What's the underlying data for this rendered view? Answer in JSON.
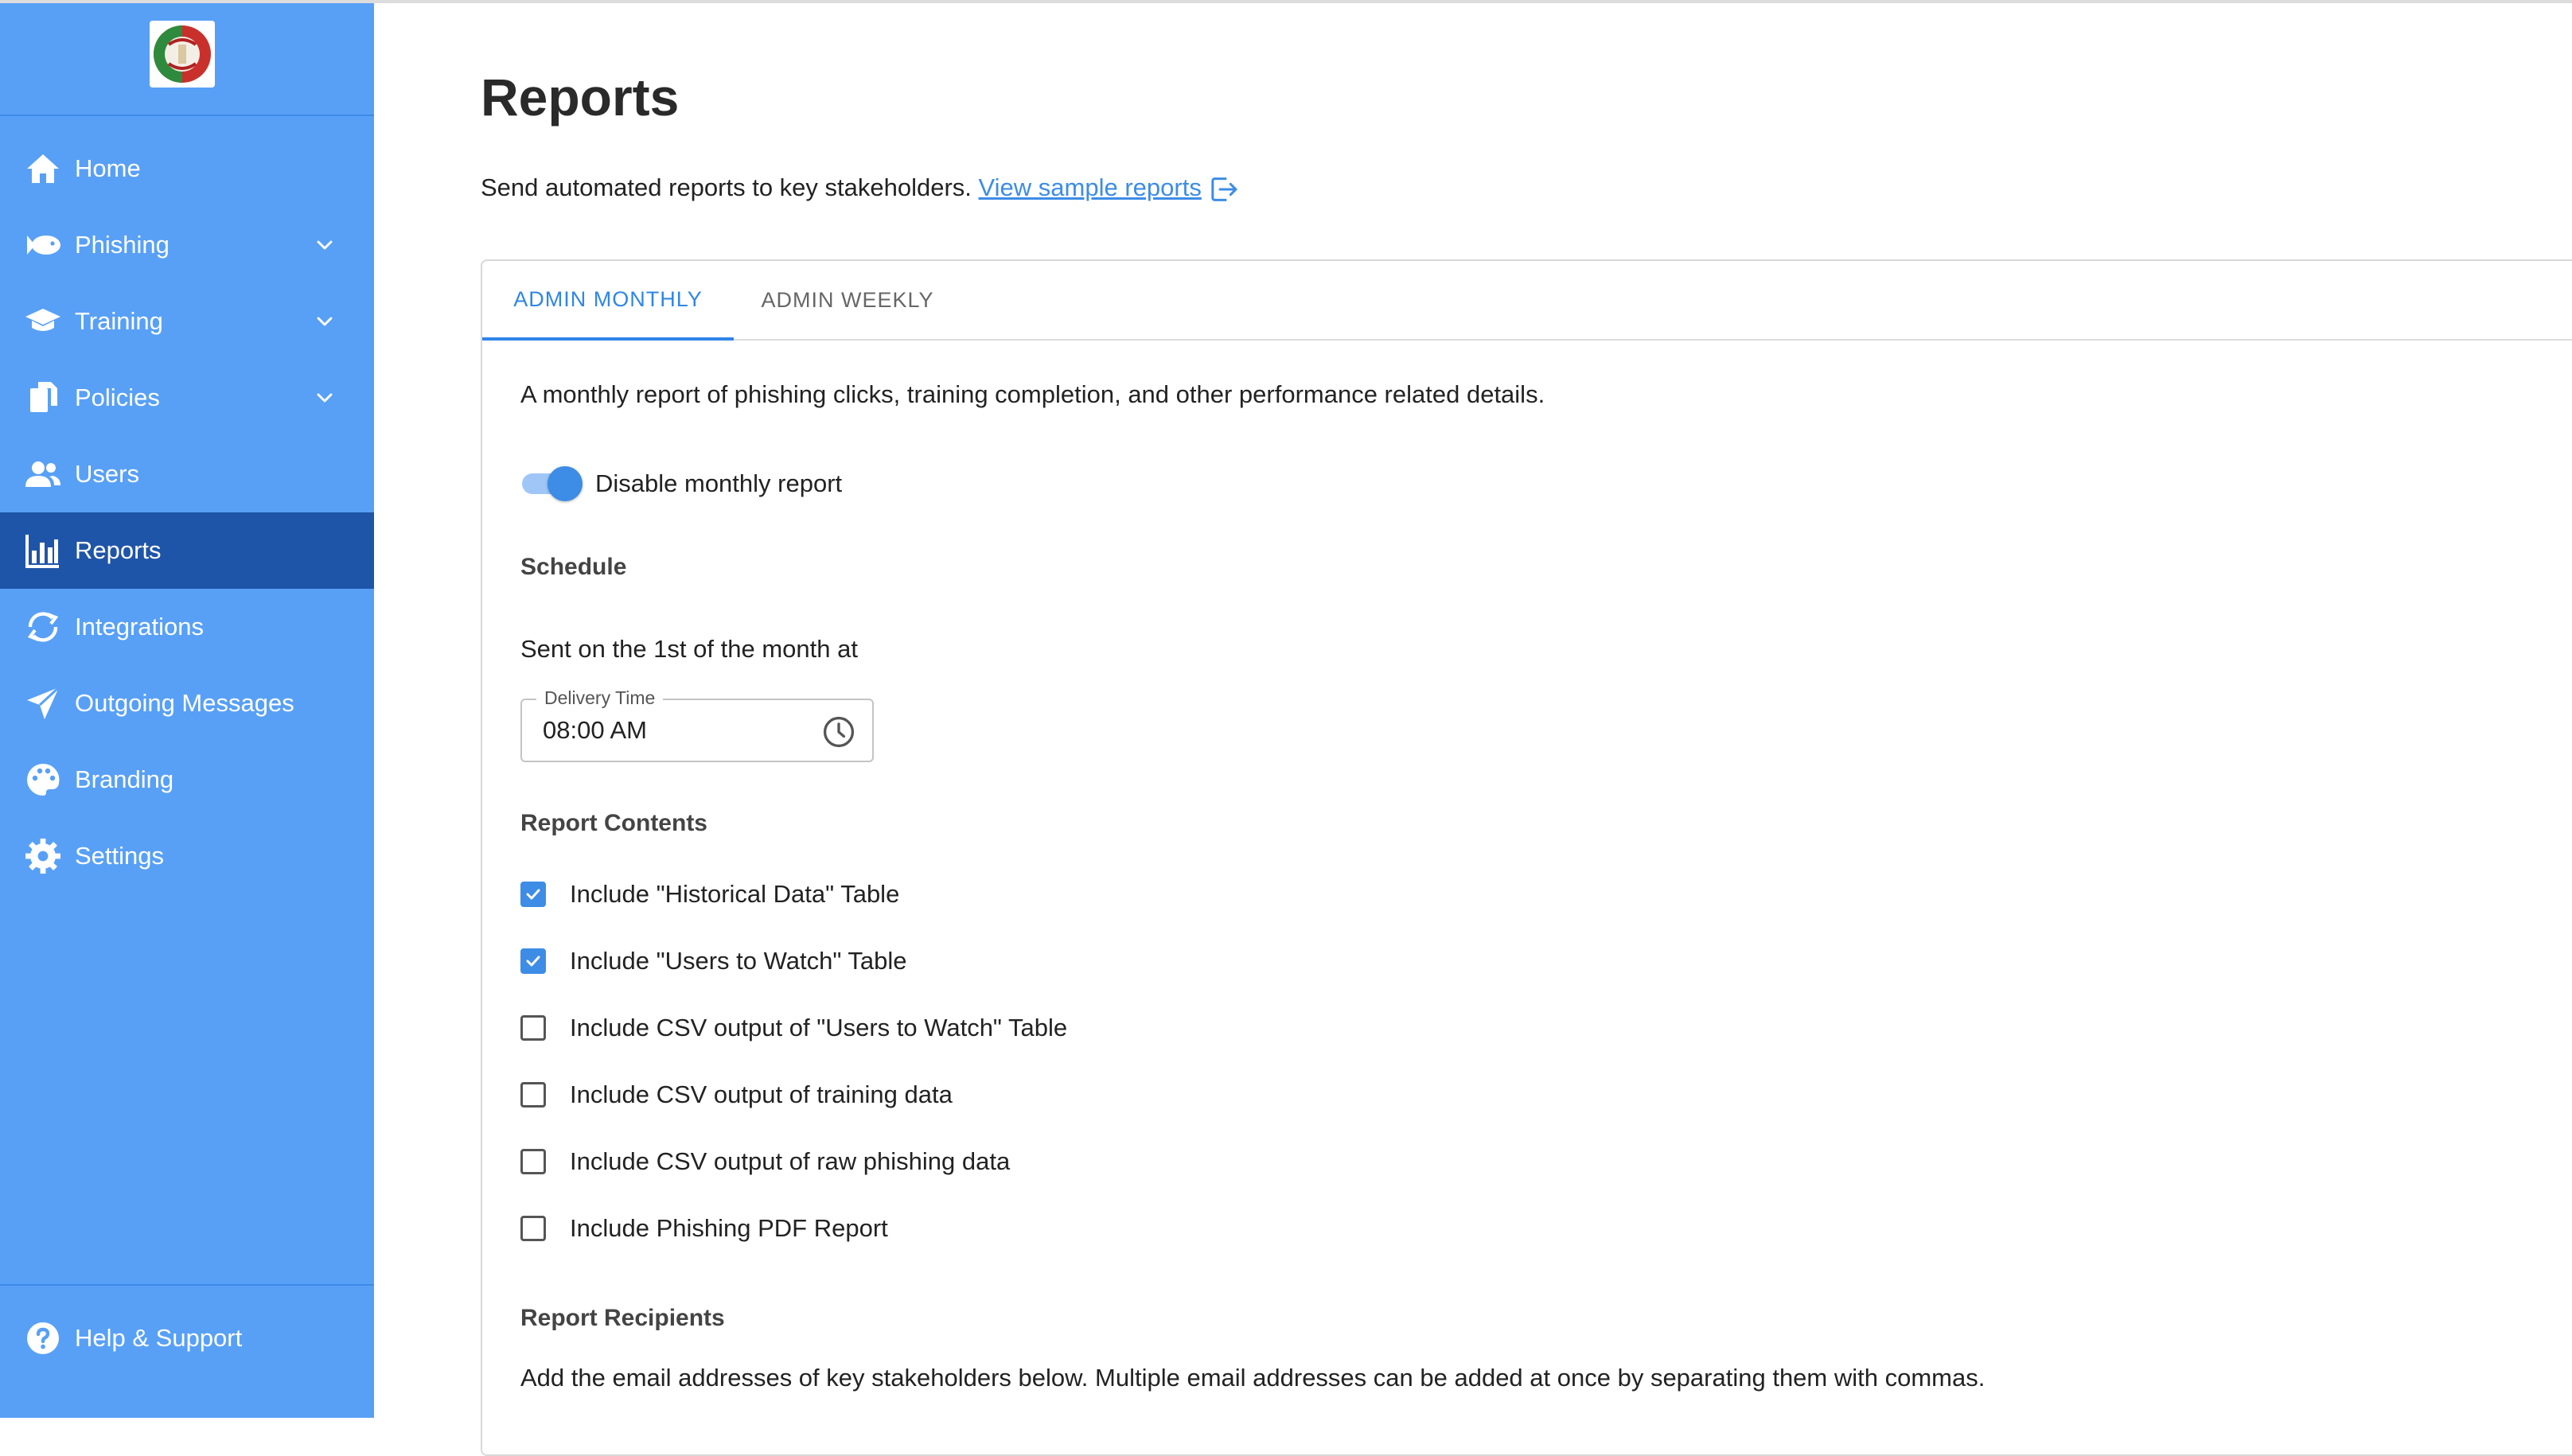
{
  "sidebar": {
    "items": [
      {
        "label": "Home",
        "icon": "home-icon"
      },
      {
        "label": "Phishing",
        "icon": "fish-icon"
      },
      {
        "label": "Training",
        "icon": "graduation-cap-icon"
      },
      {
        "label": "Policies",
        "icon": "documents-icon"
      },
      {
        "label": "Users",
        "icon": "users-icon"
      },
      {
        "label": "Reports",
        "icon": "bar-chart-icon"
      },
      {
        "label": "Integrations",
        "icon": "sync-icon"
      },
      {
        "label": "Outgoing Messages",
        "icon": "paper-plane-icon"
      },
      {
        "label": "Branding",
        "icon": "palette-icon"
      },
      {
        "label": "Settings",
        "icon": "gear-icon"
      }
    ],
    "active": "Reports",
    "help_label": "Help & Support"
  },
  "page": {
    "title": "Reports",
    "subtitle": "Send automated reports to key stakeholders.",
    "sample_link": "View sample reports"
  },
  "tabs": [
    {
      "label": "ADMIN MONTHLY",
      "active": true
    },
    {
      "label": "ADMIN WEEKLY",
      "active": false
    }
  ],
  "monthly": {
    "description": "A monthly report of phishing clicks, training completion, and other performance related details.",
    "toggle_label": "Disable monthly report",
    "toggle_on": true,
    "schedule_heading": "Schedule",
    "sent_text": "Sent on the 1st of the month at",
    "delivery_label": "Delivery Time",
    "delivery_value": "08:00 AM",
    "contents_heading": "Report Contents",
    "options": [
      {
        "label": "Include \"Historical Data\" Table",
        "checked": true
      },
      {
        "label": "Include \"Users to Watch\" Table",
        "checked": true
      },
      {
        "label": "Include CSV output of \"Users to Watch\" Table",
        "checked": false
      },
      {
        "label": "Include CSV output of training data",
        "checked": false
      },
      {
        "label": "Include CSV output of raw phishing data",
        "checked": false
      },
      {
        "label": "Include Phishing PDF Report",
        "checked": false
      }
    ],
    "recipients_heading": "Report Recipients",
    "recipients_desc": "Add the email addresses of key stakeholders below. Multiple email addresses can be added at once by separating them with commas."
  },
  "colors": {
    "sidebar": "#58a0f6",
    "sidebar_active": "#1f55a8",
    "accent": "#3d8ce6"
  }
}
